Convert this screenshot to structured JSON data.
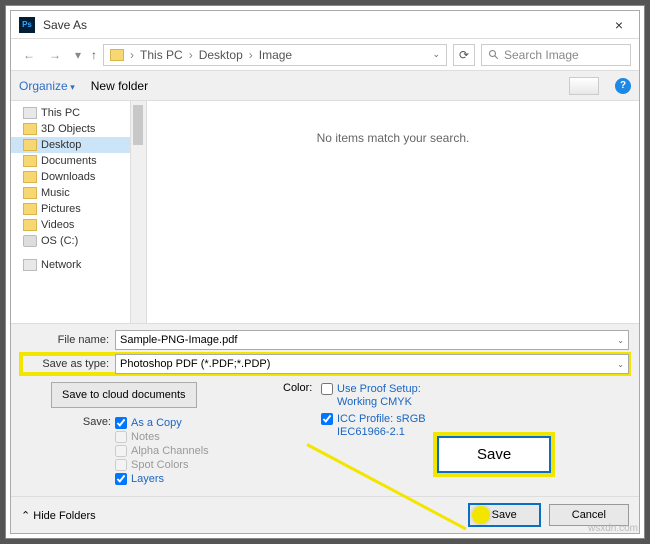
{
  "title": "Save As",
  "breadcrumb": {
    "pc": "This PC",
    "desktop": "Desktop",
    "image": "Image"
  },
  "search_placeholder": "Search Image",
  "toolbar": {
    "organize": "Organize",
    "new_folder": "New folder"
  },
  "tree": {
    "this_pc": "This PC",
    "objects3d": "3D Objects",
    "desktop": "Desktop",
    "documents": "Documents",
    "downloads": "Downloads",
    "music": "Music",
    "pictures": "Pictures",
    "videos": "Videos",
    "osc": "OS (C:)",
    "network": "Network"
  },
  "empty_msg": "No items match your search.",
  "file_name_label": "File name:",
  "file_name": "Sample-PNG-Image.pdf",
  "save_type_label": "Save as type:",
  "save_type": "Photoshop PDF (*.PDF;*.PDP)",
  "cloud_btn": "Save to cloud documents",
  "save_label": "Save:",
  "opts": {
    "as_copy": "As a Copy",
    "notes": "Notes",
    "alpha": "Alpha Channels",
    "spot": "Spot Colors",
    "layers": "Layers"
  },
  "color_label": "Color:",
  "proof1": "Use Proof Setup:",
  "proof2": "Working CMYK",
  "icc1": "ICC Profile:  sRGB",
  "icc2": "IEC61966-2.1",
  "big_save": "Save",
  "hide_folders": "Hide Folders",
  "save_btn": "Save",
  "cancel_btn": "Cancel",
  "watermark": "wsxdn.com"
}
